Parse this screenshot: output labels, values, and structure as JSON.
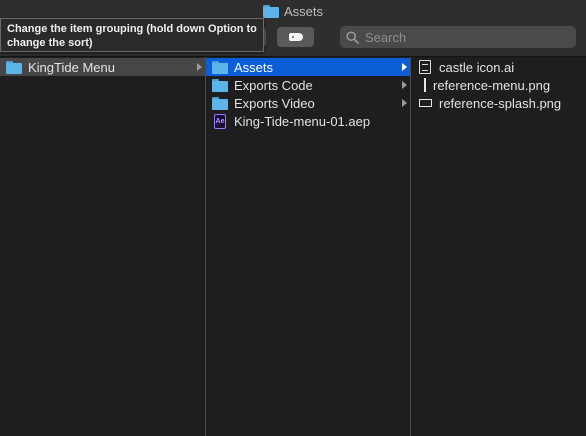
{
  "window": {
    "title": "Assets"
  },
  "toolbar": {
    "tooltip": "Change the item grouping (hold down Option to change the sort)",
    "search_placeholder": "Search"
  },
  "columns": [
    {
      "items": [
        {
          "label": "KingTide Menu",
          "icon": "folder-icon",
          "state": "selected-inactive",
          "has_children": true
        }
      ]
    },
    {
      "items": [
        {
          "label": "Assets",
          "icon": "folder-icon",
          "state": "selected",
          "has_children": true
        },
        {
          "label": "Exports Code",
          "icon": "folder-icon",
          "state": "normal",
          "has_children": true
        },
        {
          "label": "Exports Video",
          "icon": "folder-icon",
          "state": "normal",
          "has_children": true
        },
        {
          "label": "King-Tide-menu-01.aep",
          "icon": "after-effects-file-icon",
          "state": "normal",
          "has_children": false
        }
      ]
    },
    {
      "items": [
        {
          "label": "castle icon.ai",
          "icon": "document-icon",
          "state": "normal"
        },
        {
          "label": "reference-menu.png",
          "icon": "tall-image-thumbnail-icon",
          "state": "normal"
        },
        {
          "label": "reference-splash.png",
          "icon": "wide-image-thumbnail-icon",
          "state": "normal"
        }
      ]
    }
  ],
  "colors": {
    "selection": "#0b5ed7",
    "inactive_selection": "#464646",
    "folder": "#5db4e8",
    "background": "#1e1e1e"
  }
}
